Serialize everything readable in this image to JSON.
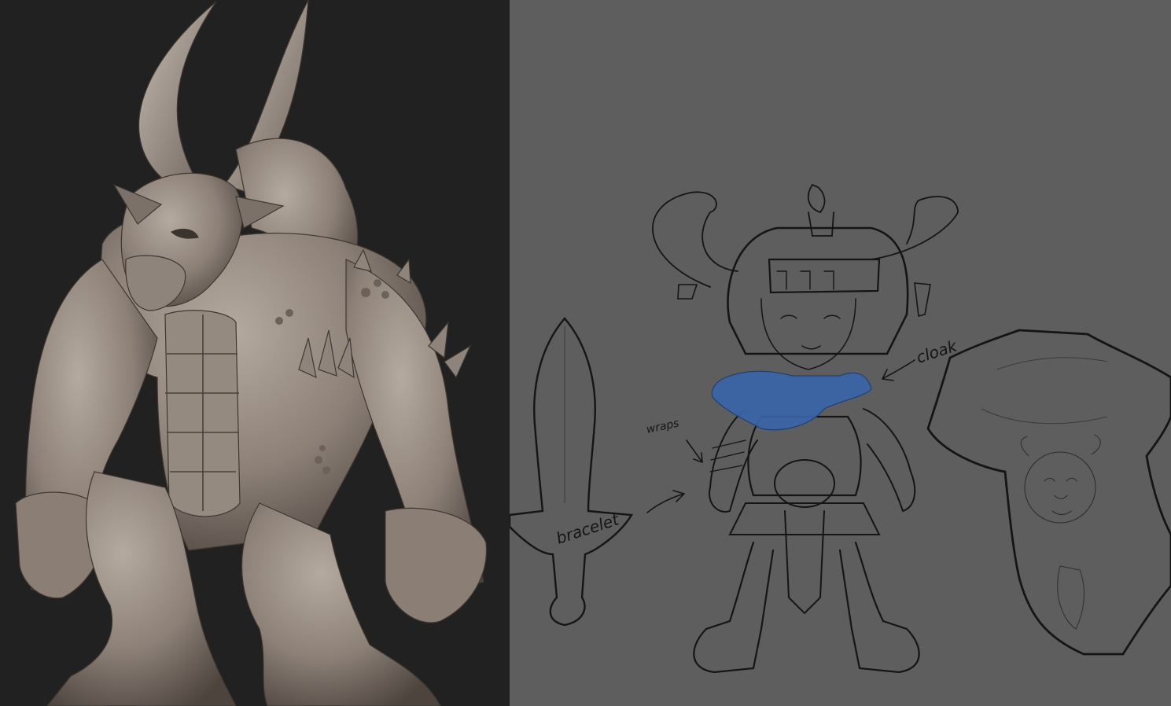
{
  "colors": {
    "sculpt_background": "#212121",
    "sketch_background": "#5e5e5e",
    "clay": "#8a7d73",
    "clay_shadow": "#4a413b",
    "clay_highlight": "#b3a79c",
    "ink": "#141414",
    "pencil": "#2b2b2b",
    "cloak_blue": "#3a64a8"
  },
  "annotations": {
    "cloak": "cloak",
    "wraps": "wraps",
    "bracelet": "bracelet"
  }
}
